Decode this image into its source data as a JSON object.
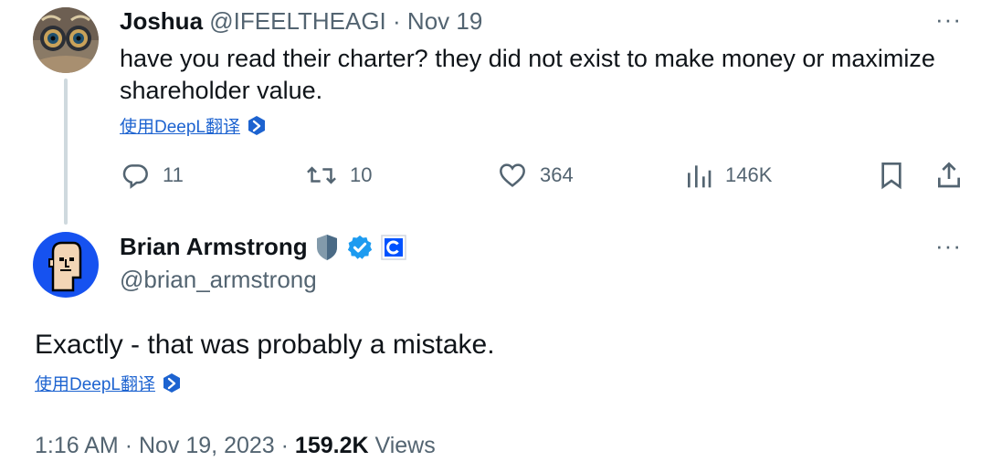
{
  "parent_tweet": {
    "display_name": "Joshua",
    "handle": "@IFEELTHEAGI",
    "separator": "·",
    "date": "Nov 19",
    "more_label": "···",
    "text": "have you read their charter? they did not exist to make money or maximize shareholder value.",
    "translate_label": "使用DeepL翻译",
    "stats": {
      "replies": "11",
      "retweets": "10",
      "likes": "364",
      "views": "146K"
    }
  },
  "main_tweet": {
    "display_name": "Brian Armstrong",
    "handle": "@brian_armstrong",
    "more_label": "···",
    "text": "Exactly - that was probably a mistake.",
    "translate_label": "使用DeepL翻译",
    "time": "1:16 AM",
    "separator": "·",
    "date": "Nov 19, 2023",
    "separator2": "·",
    "views_count": "159.2K",
    "views_label": "Views"
  },
  "colors": {
    "text_primary": "#0f1419",
    "text_muted": "#536471",
    "link_blue": "#1d63d0",
    "verified_blue": "#1d9bf0",
    "coinbase_blue": "#0052ff",
    "thread_line": "#cfd9de"
  },
  "icons": {
    "reply": "reply-icon",
    "retweet": "retweet-icon",
    "like": "heart-icon",
    "views": "views-chart-icon",
    "bookmark": "bookmark-icon",
    "share": "share-icon",
    "government_badge": "shield-badge-icon",
    "verified": "verified-badge-icon",
    "affiliate": "coinbase-affiliate-icon",
    "deepl": "deepl-icon"
  }
}
